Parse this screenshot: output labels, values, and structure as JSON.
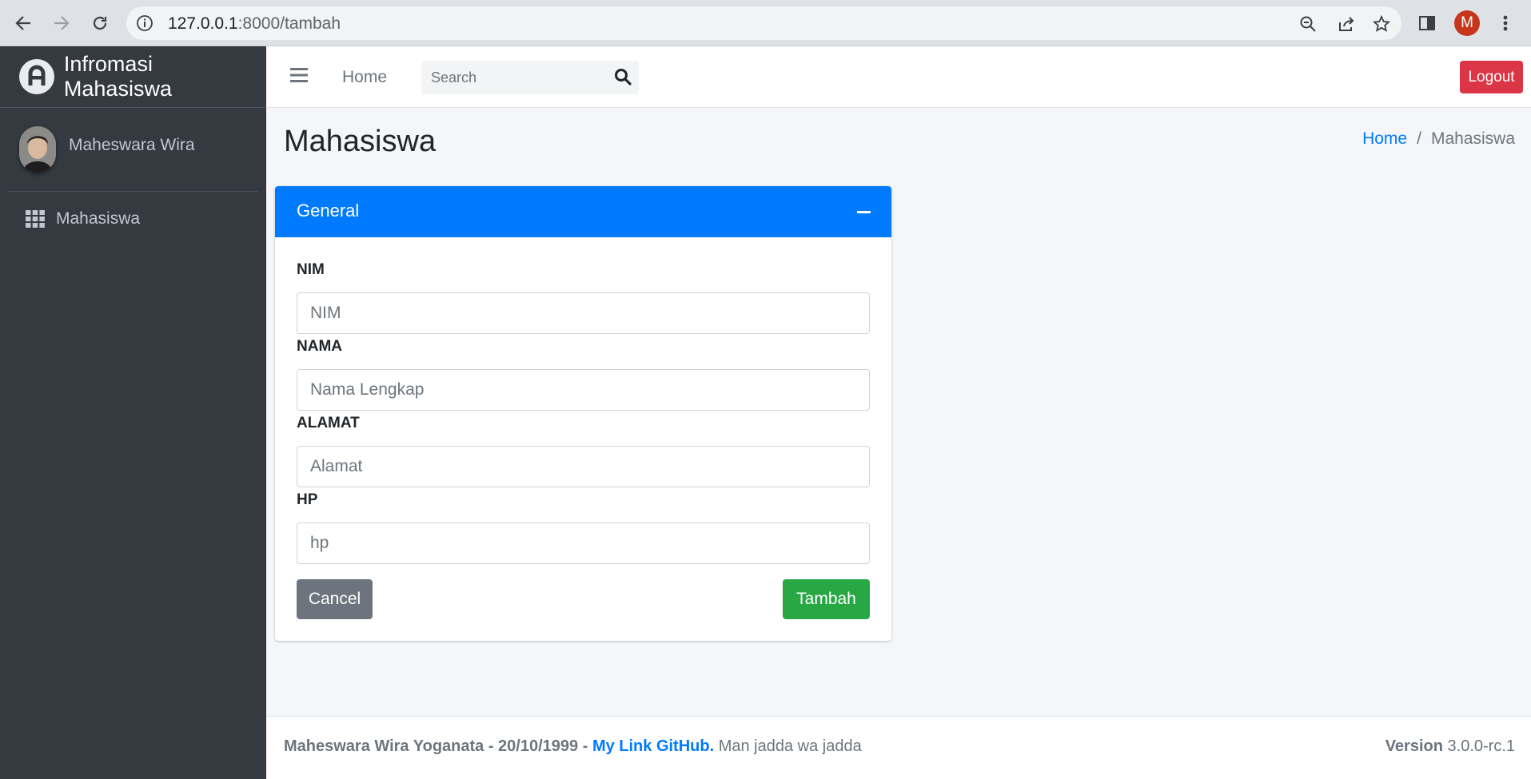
{
  "browser": {
    "url_host": "127.0.0.1",
    "url_path": ":8000/tambah",
    "profile_initial": "M"
  },
  "sidebar": {
    "brand": "Infromasi Mahasiswa",
    "user_name": "Maheswara Wira",
    "items": [
      {
        "label": "Mahasiswa",
        "icon": "grid-icon"
      }
    ]
  },
  "topbar": {
    "home_label": "Home",
    "search_placeholder": "Search",
    "logout_label": "Logout"
  },
  "content": {
    "title": "Mahasiswa",
    "breadcrumb": {
      "home": "Home",
      "separator": "/",
      "current": "Mahasiswa"
    }
  },
  "card": {
    "title": "General",
    "fields": [
      {
        "label": "NIM",
        "placeholder": "NIM"
      },
      {
        "label": "NAMA",
        "placeholder": "Nama Lengkap"
      },
      {
        "label": "ALAMAT",
        "placeholder": "Alamat"
      },
      {
        "label": "HP",
        "placeholder": "hp"
      }
    ],
    "cancel_label": "Cancel",
    "submit_label": "Tambah"
  },
  "footer": {
    "author": "Maheswara Wira Yoganata - 20/10/1999 -",
    "link": "My Link GitHub.",
    "motto": "Man jadda wa jadda",
    "version_label": "Version",
    "version": "3.0.0-rc.1"
  },
  "colors": {
    "primary": "#007bff",
    "danger": "#dc3545",
    "success": "#28a745",
    "secondary": "#6c757d",
    "sidebar": "#343a40"
  }
}
